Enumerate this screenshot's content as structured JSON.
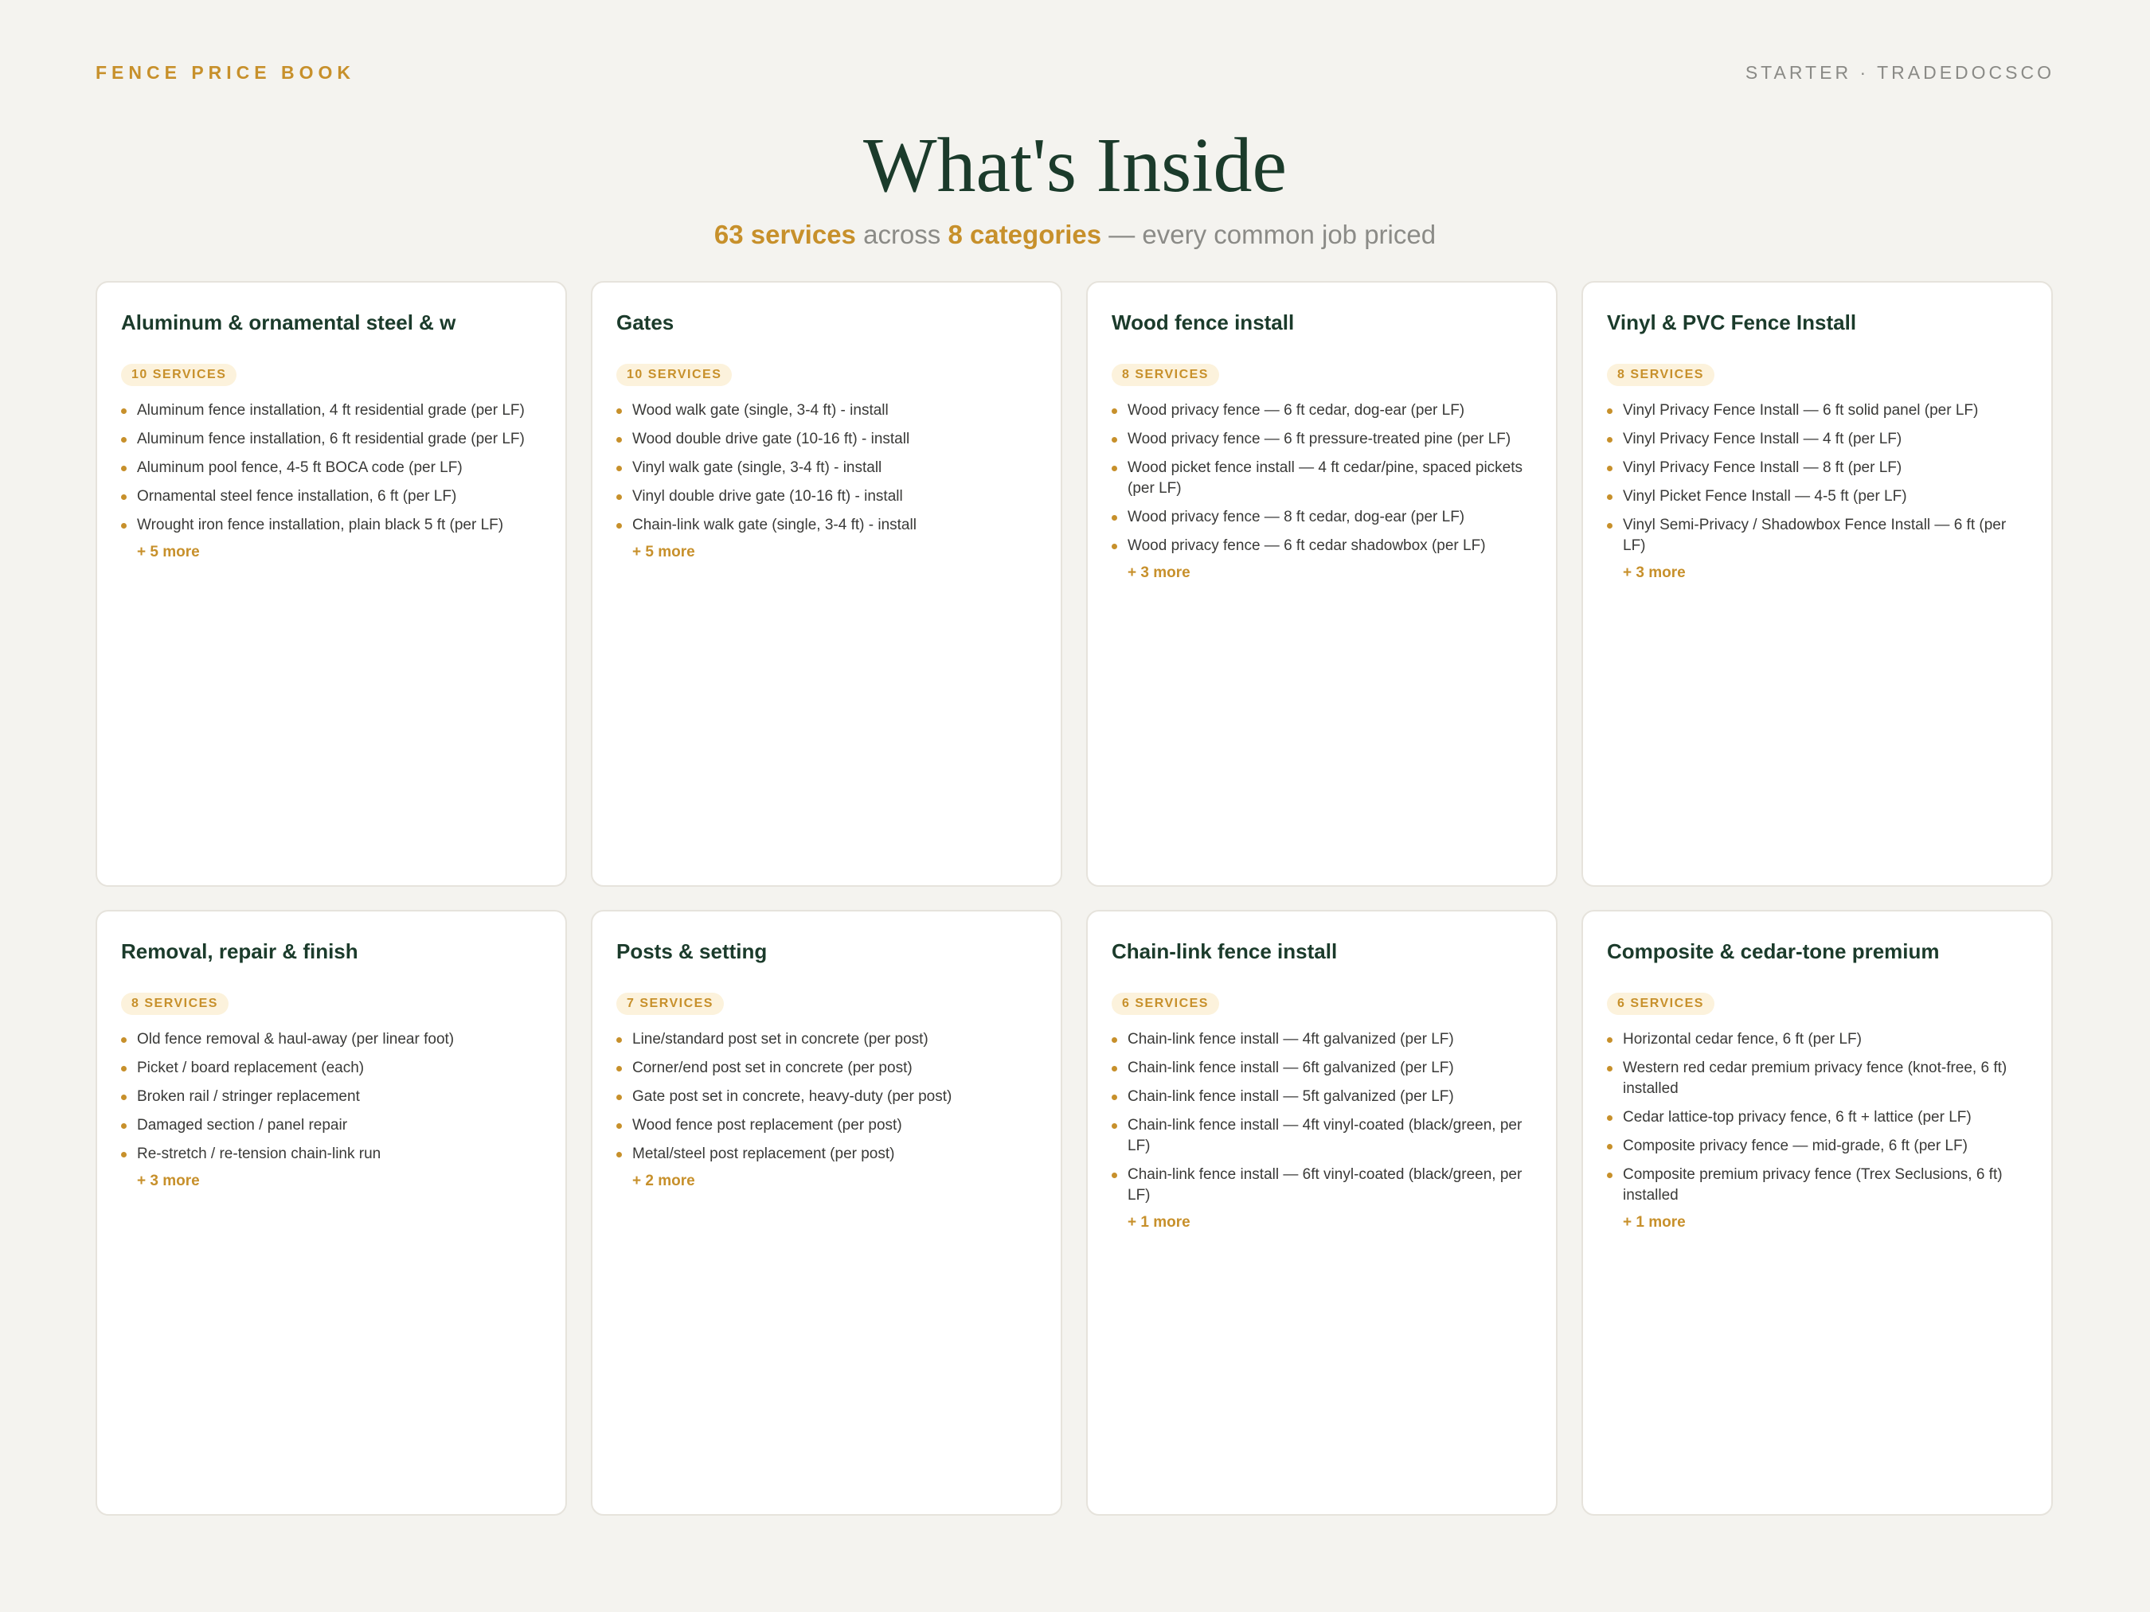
{
  "header": {
    "brand": "FENCE PRICE BOOK",
    "edition": "STARTER · TRADEDOCSCO"
  },
  "hero": {
    "title": "What's Inside",
    "subtitle": {
      "services": "63 services",
      "across": " across ",
      "categories": "8 categories",
      "rest": " — every common job priced"
    }
  },
  "cards": [
    {
      "title": "Aluminum & ornamental steel & w",
      "badge": "10 SERVICES",
      "items": [
        "Aluminum fence installation, 4 ft residential grade (per LF)",
        "Aluminum fence installation, 6 ft residential grade (per LF)",
        "Aluminum pool fence, 4-5 ft BOCA code (per LF)",
        "Ornamental steel fence installation, 6 ft (per LF)",
        "Wrought iron fence installation, plain black 5 ft (per LF)"
      ],
      "more": "+ 5 more"
    },
    {
      "title": "Gates",
      "badge": "10 SERVICES",
      "items": [
        "Wood walk gate (single, 3-4 ft) - install",
        "Wood double drive gate (10-16 ft) - install",
        "Vinyl walk gate (single, 3-4 ft) - install",
        "Vinyl double drive gate (10-16 ft) - install",
        "Chain-link walk gate (single, 3-4 ft) - install"
      ],
      "more": "+ 5 more"
    },
    {
      "title": "Wood fence install",
      "badge": "8 SERVICES",
      "items": [
        "Wood privacy fence — 6 ft cedar, dog-ear (per LF)",
        "Wood privacy fence — 6 ft pressure-treated pine (per LF)",
        "Wood picket fence install — 4 ft cedar/pine, spaced pickets (per LF)",
        "Wood privacy fence — 8 ft cedar, dog-ear (per LF)",
        "Wood privacy fence — 6 ft cedar shadowbox (per LF)"
      ],
      "more": "+ 3 more"
    },
    {
      "title": "Vinyl & PVC Fence Install",
      "badge": "8 SERVICES",
      "items": [
        "Vinyl Privacy Fence Install — 6 ft solid panel (per LF)",
        "Vinyl Privacy Fence Install — 4 ft (per LF)",
        "Vinyl Privacy Fence Install — 8 ft (per LF)",
        "Vinyl Picket Fence Install — 4-5 ft (per LF)",
        "Vinyl Semi-Privacy / Shadowbox Fence Install — 6 ft (per LF)"
      ],
      "more": "+ 3 more"
    },
    {
      "title": "Removal, repair & finish",
      "badge": "8 SERVICES",
      "items": [
        "Old fence removal & haul-away (per linear foot)",
        "Picket / board replacement (each)",
        "Broken rail / stringer replacement",
        "Damaged section / panel repair",
        "Re-stretch / re-tension chain-link run"
      ],
      "more": "+ 3 more"
    },
    {
      "title": "Posts & setting",
      "badge": "7 SERVICES",
      "items": [
        "Line/standard post set in concrete (per post)",
        "Corner/end post set in concrete (per post)",
        "Gate post set in concrete, heavy-duty (per post)",
        "Wood fence post replacement (per post)",
        "Metal/steel post replacement (per post)"
      ],
      "more": "+ 2 more"
    },
    {
      "title": "Chain-link fence install",
      "badge": "6 SERVICES",
      "items": [
        "Chain-link fence install — 4ft galvanized (per LF)",
        "Chain-link fence install — 6ft galvanized (per LF)",
        "Chain-link fence install — 5ft galvanized (per LF)",
        "Chain-link fence install — 4ft vinyl-coated (black/green, per LF)",
        "Chain-link fence install — 6ft vinyl-coated (black/green, per LF)"
      ],
      "more": "+ 1 more"
    },
    {
      "title": "Composite & cedar-tone premium",
      "badge": "6 SERVICES",
      "items": [
        "Horizontal cedar fence, 6 ft (per LF)",
        "Western red cedar premium privacy fence (knot-free, 6 ft) installed",
        "Cedar lattice-top privacy fence, 6 ft + lattice (per LF)",
        "Composite privacy fence — mid-grade, 6 ft (per LF)",
        "Composite premium privacy fence (Trex Seclusions, 6 ft) installed"
      ],
      "more": "+ 1 more"
    }
  ]
}
